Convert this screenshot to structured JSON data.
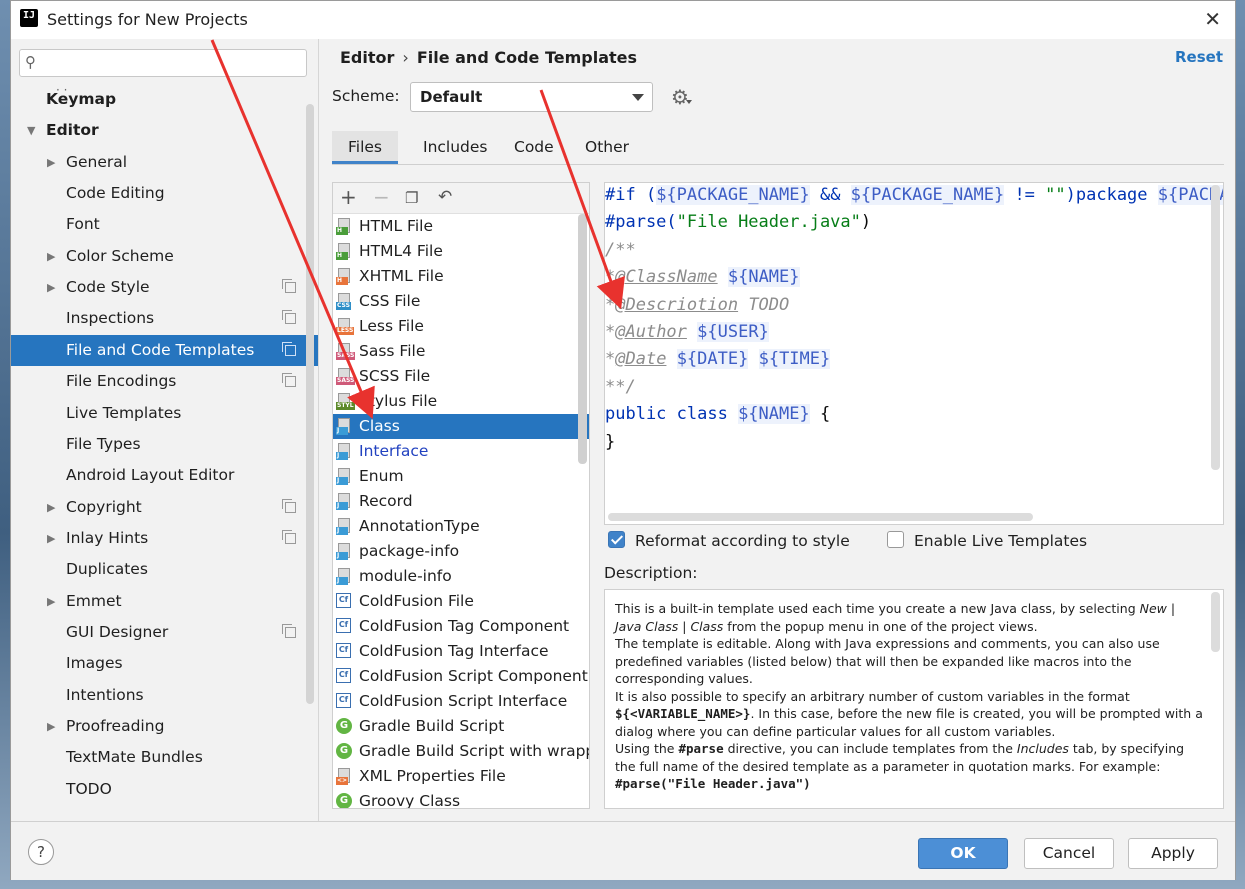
{
  "window": {
    "title": "Settings for New Projects"
  },
  "sidebar": {
    "search_placeholder": "",
    "dots": "· ·",
    "items": [
      {
        "label": "Keymap",
        "bold": true
      },
      {
        "label": "Editor",
        "bold": true,
        "expanded": true
      },
      {
        "label": "General",
        "arrow": true
      },
      {
        "label": "Code Editing"
      },
      {
        "label": "Font"
      },
      {
        "label": "Color Scheme",
        "arrow": true
      },
      {
        "label": "Code Style",
        "arrow": true,
        "copy": true
      },
      {
        "label": "Inspections",
        "copy": true
      },
      {
        "label": "File and Code Templates",
        "copy": true,
        "selected": true
      },
      {
        "label": "File Encodings",
        "copy": true
      },
      {
        "label": "Live Templates"
      },
      {
        "label": "File Types"
      },
      {
        "label": "Android Layout Editor"
      },
      {
        "label": "Copyright",
        "arrow": true,
        "copy": true
      },
      {
        "label": "Inlay Hints",
        "arrow": true,
        "copy": true
      },
      {
        "label": "Duplicates"
      },
      {
        "label": "Emmet",
        "arrow": true
      },
      {
        "label": "GUI Designer",
        "copy": true
      },
      {
        "label": "Images"
      },
      {
        "label": "Intentions"
      },
      {
        "label": "Proofreading",
        "arrow": true
      },
      {
        "label": "TextMate Bundles"
      },
      {
        "label": "TODO"
      }
    ]
  },
  "header": {
    "breadcrumb_parent": "Editor",
    "breadcrumb_sep": "›",
    "breadcrumb_current": "File and Code Templates",
    "reset": "Reset",
    "scheme_label": "Scheme:",
    "scheme_value": "Default"
  },
  "tabs": [
    {
      "label": "Files",
      "active": true
    },
    {
      "label": "Includes"
    },
    {
      "label": "Code"
    },
    {
      "label": "Other"
    }
  ],
  "templates": [
    {
      "label": "HTML File",
      "icon": "file",
      "tag": "H",
      "tag_color": "#4a9d3a"
    },
    {
      "label": "HTML4 File",
      "icon": "file",
      "tag": "H",
      "tag_color": "#4a9d3a"
    },
    {
      "label": "XHTML File",
      "icon": "file",
      "tag": "H",
      "tag_color": "#e8743b"
    },
    {
      "label": "CSS File",
      "icon": "file",
      "tag": "CSS",
      "tag_color": "#2f8fc8"
    },
    {
      "label": "Less File",
      "icon": "file",
      "tag": "LESS",
      "tag_color": "#e8743b"
    },
    {
      "label": "Sass File",
      "icon": "file",
      "tag": "SASS",
      "tag_color": "#cf5a79"
    },
    {
      "label": "SCSS File",
      "icon": "file",
      "tag": "SASS",
      "tag_color": "#cf5a79"
    },
    {
      "label": "Stylus File",
      "icon": "file",
      "tag": "STYL",
      "tag_color": "#5c8a2a"
    },
    {
      "label": "Class",
      "icon": "file",
      "tag": "J",
      "tag_color": "#3a9bd6",
      "selected": true
    },
    {
      "label": "Interface",
      "icon": "file",
      "tag": "J",
      "tag_color": "#3a9bd6",
      "blue": true
    },
    {
      "label": "Enum",
      "icon": "file",
      "tag": "J",
      "tag_color": "#3a9bd6"
    },
    {
      "label": "Record",
      "icon": "file",
      "tag": "J",
      "tag_color": "#3a9bd6"
    },
    {
      "label": "AnnotationType",
      "icon": "file",
      "tag": "J",
      "tag_color": "#3a9bd6"
    },
    {
      "label": "package-info",
      "icon": "file",
      "tag": "J",
      "tag_color": "#3a9bd6"
    },
    {
      "label": "module-info",
      "icon": "file",
      "tag": "J",
      "tag_color": "#3a9bd6"
    },
    {
      "label": "ColdFusion File",
      "icon": "cf"
    },
    {
      "label": "ColdFusion Tag Component",
      "icon": "cf"
    },
    {
      "label": "ColdFusion Tag Interface",
      "icon": "cf"
    },
    {
      "label": "ColdFusion Script Component",
      "icon": "cf"
    },
    {
      "label": "ColdFusion Script Interface",
      "icon": "cf"
    },
    {
      "label": "Gradle Build Script",
      "icon": "g"
    },
    {
      "label": "Gradle Build Script with wrappe",
      "icon": "g"
    },
    {
      "label": "XML Properties File",
      "icon": "file",
      "tag": "<>",
      "tag_color": "#e8743b"
    },
    {
      "label": "Groovy Class",
      "icon": "g"
    }
  ],
  "editor": {
    "lines": [
      [
        {
          "t": "#if (",
          "c": "c-kw"
        },
        {
          "t": "${PACKAGE_NAME}",
          "c": "c-var"
        },
        {
          "t": " && ",
          "c": "c-kw"
        },
        {
          "t": "${PACKAGE_NAME}",
          "c": "c-var"
        },
        {
          "t": " != ",
          "c": "c-kw"
        },
        {
          "t": "\"\"",
          "c": "c-str"
        },
        {
          "t": ")package ",
          "c": "c-kw"
        },
        {
          "t": "${PACKAGE_NAME};",
          "c": "c-var"
        }
      ],
      [
        {
          "t": "#parse(",
          "c": "c-kw"
        },
        {
          "t": "\"File Header.java\"",
          "c": "c-str"
        },
        {
          "t": ")",
          "c": "c-plain"
        }
      ],
      [
        {
          "t": "/**",
          "c": "c-com"
        }
      ],
      [
        {
          "t": "*",
          "c": "c-com"
        },
        {
          "t": "@ClassName",
          "c": "c-tag"
        },
        {
          "t": " ",
          "c": "c-com"
        },
        {
          "t": "${NAME}",
          "c": "c-var"
        }
      ],
      [
        {
          "t": "*",
          "c": "c-com"
        },
        {
          "t": "@Descriotion",
          "c": "c-tag"
        },
        {
          "t": " TODO",
          "c": "c-com"
        }
      ],
      [
        {
          "t": "*",
          "c": "c-com"
        },
        {
          "t": "@Author",
          "c": "c-tag"
        },
        {
          "t": " ",
          "c": "c-com"
        },
        {
          "t": "${USER}",
          "c": "c-var"
        }
      ],
      [
        {
          "t": "*",
          "c": "c-com"
        },
        {
          "t": "@Date",
          "c": "c-tag"
        },
        {
          "t": " ",
          "c": "c-com"
        },
        {
          "t": "${DATE}",
          "c": "c-var"
        },
        {
          "t": " ",
          "c": "c-com"
        },
        {
          "t": "${TIME}",
          "c": "c-var"
        }
      ],
      [
        {
          "t": "**/",
          "c": "c-com"
        }
      ],
      [
        {
          "t": "public class ",
          "c": "c-kw"
        },
        {
          "t": "${NAME}",
          "c": "c-var"
        },
        {
          "t": " {",
          "c": "c-plain"
        }
      ],
      [
        {
          "t": "}",
          "c": "c-plain"
        }
      ]
    ]
  },
  "options": {
    "reformat_label": "Reformat according to style",
    "reformat_checked": true,
    "live_label": "Enable Live Templates",
    "live_checked": false
  },
  "description": {
    "label": "Description:",
    "p1_a": "This is a built-in template used each time you create a new Java class, by selecting ",
    "p1_new": "New",
    "p1_b": " | ",
    "p1_java": "Java Class",
    "p1_c": " | ",
    "p1_class": "Class",
    "p1_d": " from the popup menu in one of the project views.",
    "p2": "The template is editable. Along with Java expressions and comments, you can also use predefined variables (listed below) that will then be expanded like macros into the corresponding values.",
    "p3_a": "It is also possible to specify an arbitrary number of custom variables in the format ",
    "p3_code": "${<VARIABLE_NAME>}",
    "p3_b": ". In this case, before the new file is created, you will be prompted with a dialog where you can define particular values for all custom variables.",
    "p4_a": "Using the ",
    "p4_code": "#parse",
    "p4_b": " directive, you can include templates from the ",
    "p4_inc": "Includes",
    "p4_c": " tab, by specifying the full name of the desired template as a parameter in quotation marks. For example:",
    "p5_code": "#parse(\"File Header.java\")"
  },
  "footer": {
    "help": "?",
    "ok": "OK",
    "cancel": "Cancel",
    "apply": "Apply"
  },
  "colors": {
    "selection": "#2675bf",
    "primary_button": "#4c8fd6",
    "annotation_arrow": "#e8322e"
  }
}
